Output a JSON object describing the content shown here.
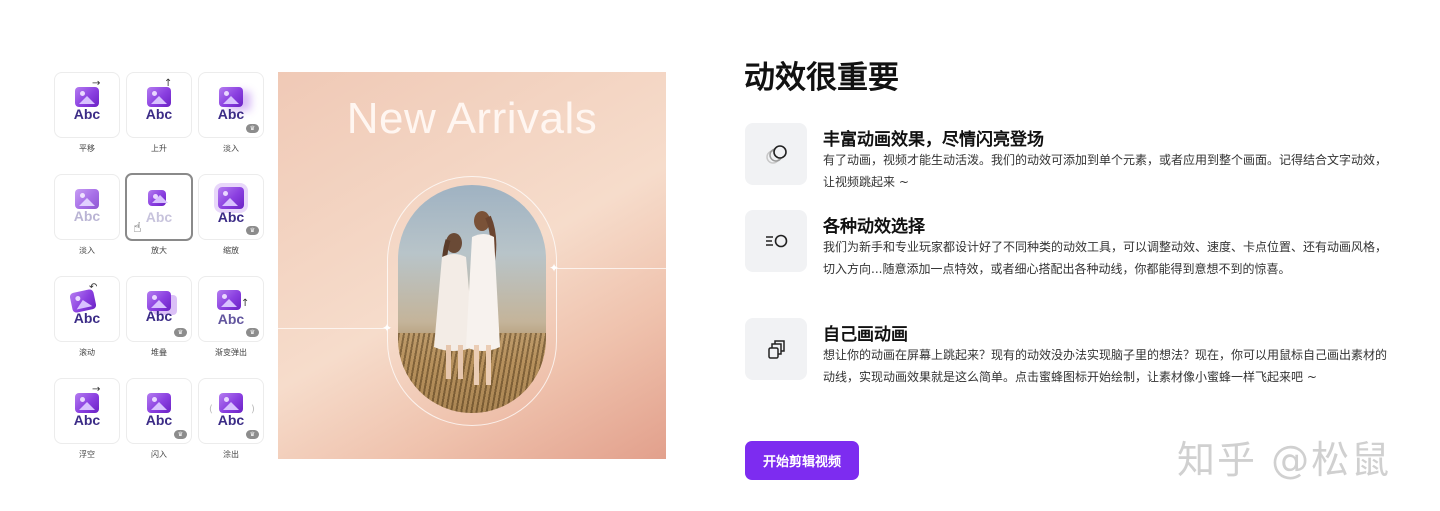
{
  "tiles": [
    {
      "label": "平移",
      "abc": "Abc",
      "arrow": "→",
      "pro": false
    },
    {
      "label": "上升",
      "abc": "Abc",
      "arrow": "↑",
      "pro": false
    },
    {
      "label": "淡入",
      "abc": "Abc",
      "arrow": "",
      "pro": true
    },
    {
      "label": "淡入",
      "abc": "Abc",
      "arrow": "",
      "pro": false
    },
    {
      "label": "放大",
      "abc": "Abc",
      "arrow": "",
      "pro": false
    },
    {
      "label": "缩放",
      "abc": "Abc",
      "arrow": "",
      "pro": true
    },
    {
      "label": "滚动",
      "abc": "Abc",
      "arrow": "↶",
      "pro": false
    },
    {
      "label": "堆叠",
      "abc": "Abc",
      "arrow": "",
      "pro": true
    },
    {
      "label": "渐变弹出",
      "abc": "Abc",
      "arrow": "↑",
      "pro": true
    },
    {
      "label": "浮空",
      "abc": "Abc",
      "arrow": "→",
      "pro": false
    },
    {
      "label": "闪入",
      "abc": "Abc",
      "arrow": "",
      "pro": true
    },
    {
      "label": "涂出",
      "abc": "Abc",
      "arrow": "",
      "pro": true
    }
  ],
  "preview": {
    "title": "New Arrivals"
  },
  "heading": "动效很重要",
  "features": [
    {
      "icon": "overlapping-circles-icon",
      "title": "丰富动画效果，尽情闪亮登场",
      "description": "有了动画，视频才能生动活泼。我们的动效可添加到单个元素，或者应用到整个画面。记得结合文字动效，让视频跳起来 ~"
    },
    {
      "icon": "motion-circle-icon",
      "title": "各种动效选择",
      "description": "我们为新手和专业玩家都设计好了不同种类的动效工具，可以调整动效、速度、卡点位置、还有动画风格，切入方向...随意添加一点特效，或者细心搭配出各种动线，你都能得到意想不到的惊喜。"
    },
    {
      "icon": "copy-layers-icon",
      "title": "自己画动画",
      "description": "想让你的动画在屏幕上跳起来？现有的动效没办法实现脑子里的想法？现在，你可以用鼠标自己画出素材的动线，实现动画效果就是这么简单。点击蜜蜂图标开始绘制，让素材像小蜜蜂一样飞起来吧 ~"
    }
  ],
  "cta_label": "开始剪辑视频",
  "watermark": "知乎 @松鼠",
  "colors": {
    "accent": "#7d2cf0",
    "tile_image": "#8a3fe0",
    "abc_text": "#3b2b86"
  }
}
